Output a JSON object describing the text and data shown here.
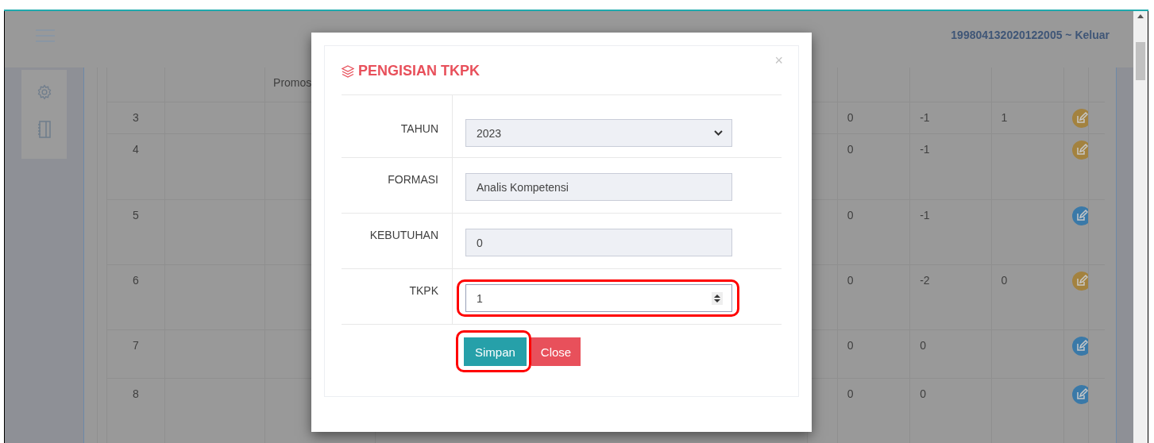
{
  "header": {
    "user_link": "199804132020122005 ~ Keluar"
  },
  "table": {
    "rows": [
      {
        "col_3": "Promos"
      },
      {
        "number": "3",
        "values": [
          "0",
          "-1",
          "1"
        ],
        "color": "#a3823f"
      },
      {
        "number": "4",
        "values": [
          "0",
          "-1"
        ],
        "color": "#a3823f"
      },
      {
        "number": "5",
        "values": [
          "0",
          "-1"
        ],
        "color": "#3a79a8"
      },
      {
        "number": "6",
        "values": [
          "0",
          "-2",
          "0"
        ],
        "color": "#a3823f"
      },
      {
        "number": "7",
        "values": [
          "0",
          "0"
        ],
        "color": "#3a79a8"
      },
      {
        "number": "8",
        "values": [
          "0",
          "0"
        ],
        "color": "#3a79a8"
      }
    ]
  },
  "modal": {
    "title": "PENGISIAN TKPK",
    "close": "×",
    "fields": [
      {
        "label": "TAHUN",
        "kind": "select",
        "value": "2023",
        "highlighted": false
      },
      {
        "label": "FORMASI",
        "kind": "readonly",
        "value": "Analis Kompetensi",
        "highlighted": false
      },
      {
        "label": "KEBUTUHAN",
        "kind": "readonly",
        "value": "0",
        "highlighted": false
      },
      {
        "label": "TKPK",
        "kind": "number",
        "value": "1",
        "highlighted": true
      }
    ],
    "buttons": [
      {
        "label": "Simpan",
        "kind": "primary",
        "highlighted": true
      },
      {
        "label": "Close",
        "kind": "danger",
        "highlighted": false
      }
    ]
  }
}
